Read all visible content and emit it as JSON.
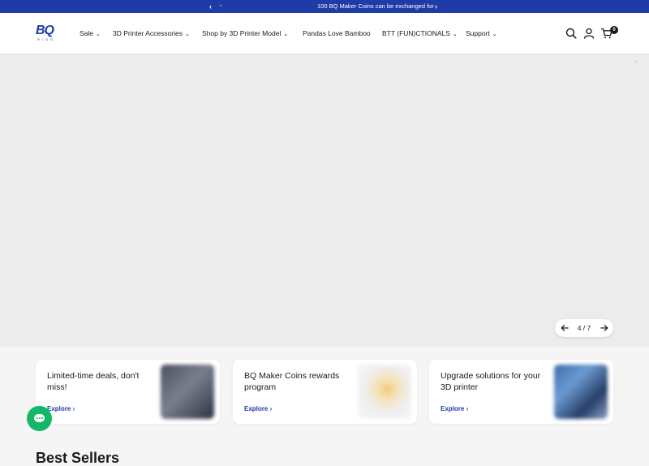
{
  "announcement": {
    "prev": "‹",
    "dot": "•",
    "message": "100 BQ Maker Coins can be exchanged for",
    "next": "›"
  },
  "logo": {
    "mark": "BQ",
    "subtitle": "RIGO"
  },
  "nav": [
    {
      "label": "Sale",
      "has_dropdown": true
    },
    {
      "label": "3D Printer Accessories",
      "has_dropdown": true
    },
    {
      "label": "Shop by 3D Printer Model",
      "has_dropdown": true
    },
    {
      "label": "Pandas Love Bamboo",
      "has_dropdown": false
    },
    {
      "label": "BTT (FUN)CTIONALS",
      "has_dropdown": true
    },
    {
      "label": "Support",
      "has_dropdown": true
    }
  ],
  "header_icons": [
    "search-icon",
    "account-icon",
    "cart-icon"
  ],
  "cart": {
    "count": "0"
  },
  "hero": {
    "close": "×"
  },
  "slider": {
    "current": "4",
    "total": "7",
    "label": "4 / 7"
  },
  "cards": [
    {
      "title": "Limited-time deals, don't miss!",
      "link": "Explore"
    },
    {
      "title": "BQ Maker Coins rewards program",
      "link": "Explore"
    },
    {
      "title": "Upgrade solutions for your 3D printer",
      "link": "Explore"
    }
  ],
  "section": {
    "title": "Best Sellers"
  },
  "colors": {
    "brand": "#1f3ba5",
    "chat": "#12b76a",
    "hero_bg": "#ececec"
  }
}
